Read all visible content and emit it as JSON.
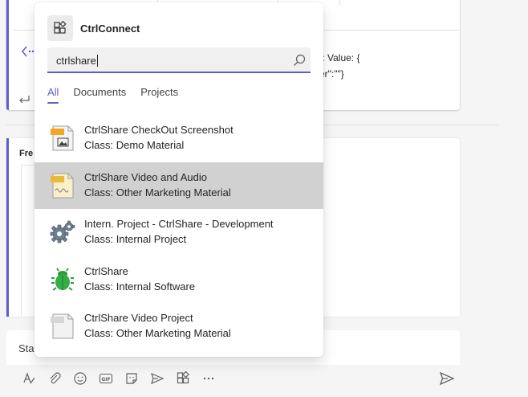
{
  "chat": {
    "code_line_1": "t: Value: {",
    "code_line_2": "er\":\"\"}",
    "card_label": "Fre",
    "compose_placeholder": "Sta"
  },
  "flyout": {
    "app_name": "CtrlConnect",
    "search": {
      "value": "ctrlshare"
    },
    "tabs": [
      {
        "label": "All",
        "active": true
      },
      {
        "label": "Documents",
        "active": false
      },
      {
        "label": "Projects",
        "active": false
      }
    ],
    "results": [
      {
        "title": "CtrlShare CheckOut Screenshot",
        "class": "Class: Demo Material",
        "icon": "image-document-icon"
      },
      {
        "title": "CtrlShare Video and Audio",
        "class": "Class: Other Marketing Material",
        "icon": "media-document-icon"
      },
      {
        "title": "Intern. Project - CtrlShare - Development",
        "class": "Class: Internal Project",
        "icon": "gears-icon"
      },
      {
        "title": "CtrlShare",
        "class": "Class: Internal Software",
        "icon": "bug-icon"
      },
      {
        "title": "CtrlShare Video Project",
        "class": "Class: Other Marketing Material",
        "icon": "gray-document-icon"
      }
    ]
  },
  "colors": {
    "accent": "#5b5fc7",
    "selected_row": "#d1d1d1"
  }
}
